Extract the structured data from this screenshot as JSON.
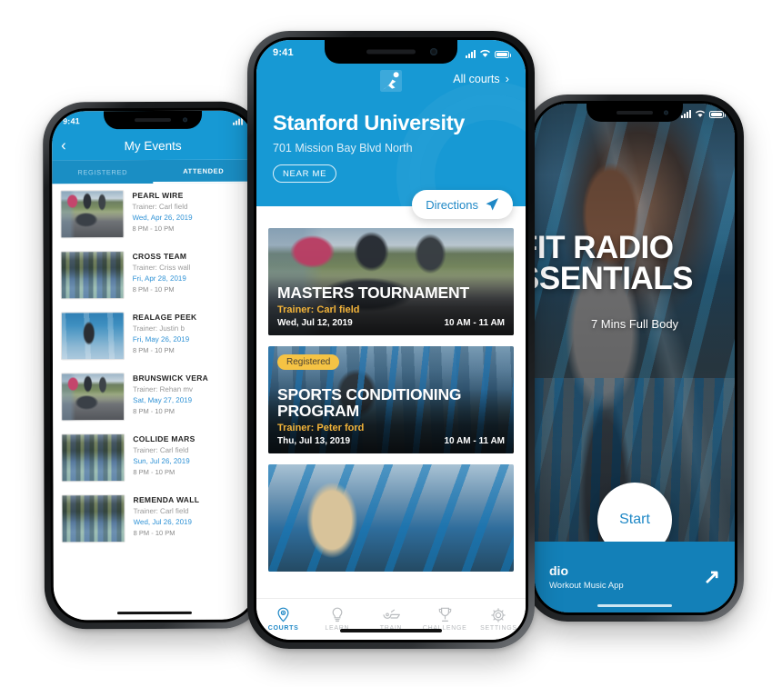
{
  "left_phone": {
    "status": {
      "time": "9:41"
    },
    "header": {
      "back_icon": "chevron-left-icon",
      "title": "My Events"
    },
    "tabs": [
      {
        "label": "REGISTERED",
        "active": false
      },
      {
        "label": "ATTENDED",
        "active": true
      }
    ],
    "events": [
      {
        "name": "PEARL WIRE",
        "trainer": "Trainer: Carl field",
        "date": "Wed, Apr 26, 2019",
        "time": "8 PM - 10 PM",
        "thumb": "img-park"
      },
      {
        "name": "CROSS TEAM",
        "trainer": "Trainer: Criss wall",
        "date": "Fri, Apr 28, 2019",
        "time": "8 PM - 10 PM",
        "thumb": "img-crowd"
      },
      {
        "name": "REALAGE PEEK",
        "trainer": "Trainer: Justin b",
        "date": "Fri, May 26, 2019",
        "time": "8 PM - 10 PM",
        "thumb": "img-lunge"
      },
      {
        "name": "BRUNSWICK VERA",
        "trainer": "Trainer: Rehan mv",
        "date": "Sat, May 27, 2019",
        "time": "8 PM - 10 PM",
        "thumb": "img-park"
      },
      {
        "name": "COLLIDE MARS",
        "trainer": "Trainer: Carl field",
        "date": "Sun, Jul 26, 2019",
        "time": "8 PM - 10 PM",
        "thumb": "img-crowd"
      },
      {
        "name": "REMENDA WALL",
        "trainer": "Trainer: Carl field",
        "date": "Wed, Jul 26, 2019",
        "time": "8 PM - 10 PM",
        "thumb": "img-crowd"
      }
    ]
  },
  "center_phone": {
    "status": {
      "time": "9:41"
    },
    "header": {
      "logo_icon": "athlete-logo-icon",
      "all_courts_label": "All courts",
      "chevron_icon": "chevron-right-icon",
      "venue": "Stanford University",
      "address": "701 Mission Bay Blvd North",
      "near_me_label": "NEAR ME"
    },
    "directions": {
      "label": "Directions",
      "icon": "navigation-arrow-icon"
    },
    "cards": [
      {
        "title": "MASTERS TOURNAMENT",
        "trainer": "Trainer: Carl field",
        "date": "Wed, Jul 12, 2019",
        "time": "10 AM - 11 AM",
        "badge": null,
        "photo": "img-park"
      },
      {
        "title_line1": "SPORTS CONDITIONING",
        "title_line2": "PROGRAM",
        "trainer": "Trainer: Peter ford",
        "date": "Thu, Jul 13, 2019",
        "time": "10 AM - 11 AM",
        "badge": "Registered",
        "photo": "img-gym"
      },
      {
        "photo": "img-blonde"
      }
    ],
    "tabbar": [
      {
        "label": "COURTS",
        "icon": "location-pin-icon",
        "active": true
      },
      {
        "label": "LEARN",
        "icon": "lightbulb-icon",
        "active": false
      },
      {
        "label": "TRAIN",
        "icon": "whistle-icon",
        "active": false
      },
      {
        "label": "CHALLENGE",
        "icon": "trophy-icon",
        "active": false
      },
      {
        "label": "SETTINGS",
        "icon": "gear-icon",
        "active": false
      }
    ]
  },
  "right_phone": {
    "title_line1": "FIT RADIO",
    "title_line2": "SSENTIALS",
    "subtitle": "7 Mins  Full Body",
    "start_label": "Start",
    "banner": {
      "title": "dio",
      "subtitle": "Workout Music App",
      "icon": "external-link-arrow-icon"
    }
  },
  "colors": {
    "brand_blue": "#1799d4",
    "link_blue": "#1f88c6",
    "badge_yellow": "#f5c344",
    "trainer_amber": "#f2b339"
  }
}
